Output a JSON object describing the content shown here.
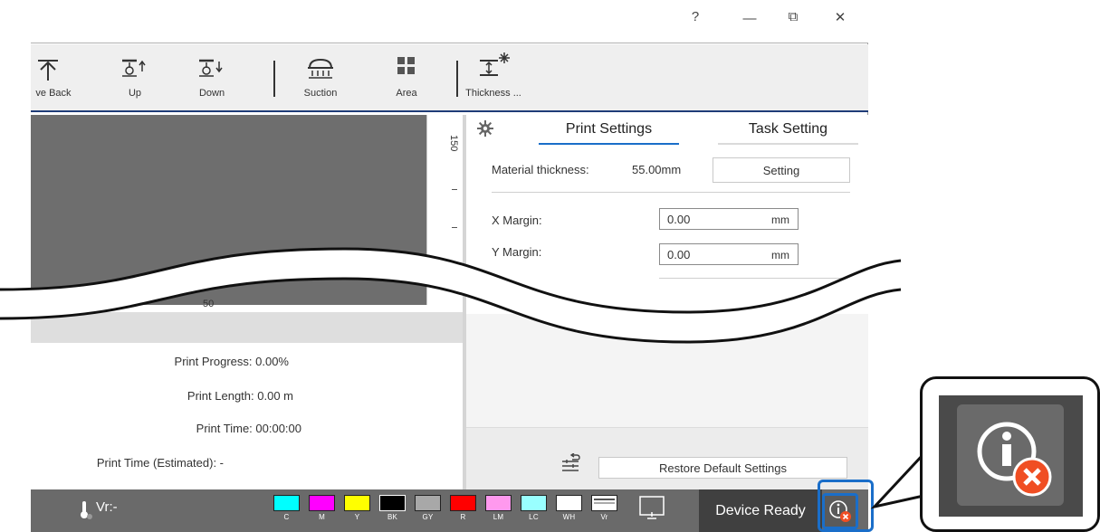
{
  "window": {
    "controls": {
      "help": "?",
      "minimize": "—",
      "restore": "⧉",
      "close": "✕"
    }
  },
  "toolbar": {
    "items": [
      {
        "label": "ve Back",
        "icon": "move-back-icon"
      },
      {
        "label": "Up",
        "icon": "up-icon"
      },
      {
        "label": "Down",
        "icon": "down-icon"
      },
      {
        "label": "Suction",
        "icon": "suction-icon"
      },
      {
        "label": "Area",
        "icon": "area-icon"
      },
      {
        "label": "Thickness ...",
        "icon": "thickness-icon"
      }
    ]
  },
  "preview": {
    "ruler_v_label": "150",
    "ruler_h_label": "50"
  },
  "print_info": {
    "progress": "Print Progress: 0.00%",
    "length": "Print Length: 0.00 m",
    "time": "Print Time: 00:00:00",
    "time_estimated": "Print Time (Estimated): -"
  },
  "settings_panel": {
    "tabs": [
      {
        "label": "Print Settings",
        "active": true
      },
      {
        "label": "Task Setting",
        "active": false
      }
    ],
    "material_thickness_label": "Material thickness:",
    "material_thickness_value": "55.00mm",
    "setting_button": "Setting",
    "x_margin_label": "X Margin:",
    "x_margin_value": "0.00",
    "x_margin_unit": "mm",
    "y_margin_label": "Y Margin:",
    "y_margin_value": "0.00",
    "y_margin_unit": "mm",
    "restore_button": "Restore Default Settings"
  },
  "status_bar": {
    "vr_text": "Vr:-",
    "inks": [
      {
        "label": "C",
        "color": "#00ffff"
      },
      {
        "label": "M",
        "color": "#ff00ff"
      },
      {
        "label": "Y",
        "color": "#ffff00"
      },
      {
        "label": "BK",
        "color": "#000000"
      },
      {
        "label": "GY",
        "color": "#a8a8a8"
      },
      {
        "label": "R",
        "color": "#ff0000"
      },
      {
        "label": "LM",
        "color": "#ff99ee"
      },
      {
        "label": "LC",
        "color": "#99ffff"
      },
      {
        "label": "WH",
        "color": "#ffffff"
      },
      {
        "label": "Vr",
        "color": "#ffffff"
      }
    ],
    "device_status": "Device Ready"
  },
  "colors": {
    "accent": "#1f3d78",
    "tab_active_underline": "#1a6ec9",
    "status_bar": "#6a6a6a",
    "highlight": "#1a6ec9",
    "error": "#f04e23"
  }
}
